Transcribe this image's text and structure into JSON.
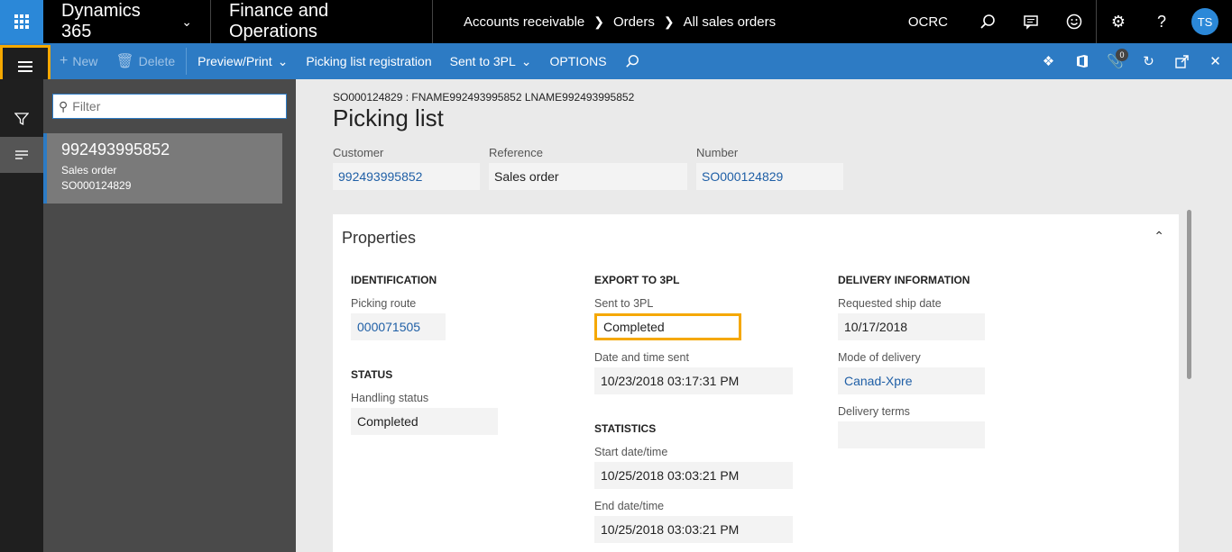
{
  "topnav": {
    "brand": "Dynamics 365",
    "app": "Finance and Operations",
    "breadcrumb": [
      "Accounts receivable",
      "Orders",
      "All sales orders"
    ],
    "company": "OCRC",
    "avatar_initials": "TS",
    "icons": [
      "search-icon",
      "message-icon",
      "smiley-icon",
      "gear-icon",
      "help-icon"
    ]
  },
  "actionbar": {
    "new": "New",
    "delete": "Delete",
    "preview_print": "Preview/Print",
    "picking_list_registration": "Picking list registration",
    "sent_to_3pl": "Sent to 3PL",
    "options": "OPTIONS",
    "notification_count": "0",
    "accent": "#2d7bc4"
  },
  "list": {
    "filter_placeholder": "Filter",
    "items": [
      {
        "title": "992493995852",
        "line1": "Sales order",
        "line2": "SO000124829"
      }
    ]
  },
  "main": {
    "caption": "SO000124829 : FNAME992493995852 LNAME992493995852",
    "title": "Picking list",
    "header_fields": {
      "customer_label": "Customer",
      "customer_value": "992493995852",
      "reference_label": "Reference",
      "reference_value": "Sales order",
      "number_label": "Number",
      "number_value": "SO000124829"
    },
    "properties": {
      "heading": "Properties",
      "identification": {
        "title": "IDENTIFICATION",
        "picking_route_label": "Picking route",
        "picking_route_value": "000071505"
      },
      "status": {
        "title": "STATUS",
        "handling_status_label": "Handling status",
        "handling_status_value": "Completed"
      },
      "export": {
        "title": "EXPORT TO 3PL",
        "sent_label": "Sent to 3PL",
        "sent_value": "Completed",
        "datetime_label": "Date and time sent",
        "datetime_value": "10/23/2018 03:17:31 PM"
      },
      "statistics": {
        "title": "STATISTICS",
        "start_label": "Start date/time",
        "start_value": "10/25/2018 03:03:21 PM",
        "end_label": "End date/time",
        "end_value": "10/25/2018 03:03:21 PM"
      },
      "delivery": {
        "title": "DELIVERY INFORMATION",
        "ship_date_label": "Requested ship date",
        "ship_date_value": "10/17/2018",
        "mode_label": "Mode of delivery",
        "mode_value": "Canad-Xpre",
        "terms_label": "Delivery terms",
        "terms_value": ""
      }
    }
  }
}
